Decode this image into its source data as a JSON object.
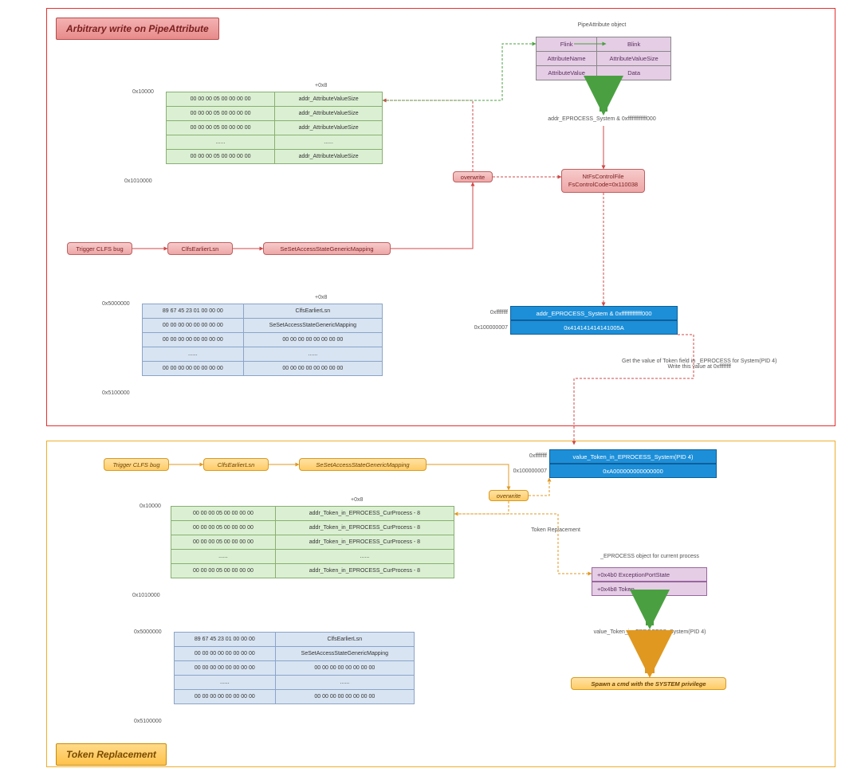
{
  "panel1": {
    "title": "Arbitrary write on PipeAttribute",
    "pipeattr_title": "PipeAttribute object",
    "pipeattr_cells": [
      "Flink",
      "Blink",
      "AttributeName",
      "AttributeValueSize",
      "AttributeValue",
      "Data"
    ],
    "addr_mask": "addr_EPROCESS_System & 0xfffffffffffff000",
    "ntfs": {
      "l1": "NtFsControlFile",
      "l2": "FsControlCode=0x110038"
    },
    "overwrite": "overwrite",
    "chain": [
      "Trigger CLFS bug",
      "ClfsEarlierLsn",
      "SeSetAccessStateGenericMapping"
    ],
    "greentbl": {
      "hdr": "+0x8",
      "addr_top": "0x10000",
      "addr_bot": "0x1010000",
      "rows": [
        [
          "00 00 00 05 00 00 00 00",
          "addr_AttributeValueSize"
        ],
        [
          "00 00 00 05 00 00 00 00",
          "addr_AttributeValueSize"
        ],
        [
          "00 00 00 05 00 00 00 00",
          "addr_AttributeValueSize"
        ],
        [
          "......",
          "......"
        ],
        [
          "00 00 00 05 00 00 00 00",
          "addr_AttributeValueSize"
        ]
      ]
    },
    "bluetbl": {
      "hdr": "+0x8",
      "addr_top": "0x5000000",
      "addr_bot": "0x5100000",
      "rows": [
        [
          "89 67 45 23 01 00 00 00",
          "ClfsEarlierLsn"
        ],
        [
          "00 00 00 00 00 00 00 00",
          "SeSetAccessStateGenericMapping"
        ],
        [
          "00 00 00 00 00 00 00 00",
          "00 00 00 00 00 00 00 00"
        ],
        [
          "......",
          "......"
        ],
        [
          "00 00 00 00 00 00 00 00",
          "00 00 00 00 00 00 00 00"
        ]
      ]
    },
    "bluewrite": {
      "addr1": "0xffffffff",
      "val1": "addr_EPROCESS_System & 0xfffffffffffff000",
      "addr2": "0x100000007",
      "val2": "0x414141414141005A"
    },
    "note": "Get the value of Token field in _EPROCESS for System(PID 4)\nWrite this value at 0xffffffff"
  },
  "panel2": {
    "title": "Token Replacement",
    "chain": [
      "Trigger CLFS bug",
      "ClfsEarlierLsn",
      "SeSetAccessStateGenericMapping"
    ],
    "overwrite": "overwrite",
    "bluewrite": {
      "addr1": "0xffffffff",
      "val1": "value_Token_in_EPROCESS_System(PID 4)",
      "addr2": "0x100000007",
      "val2": "0xA000000000000000"
    },
    "greentbl": {
      "hdr": "+0x8",
      "addr_top": "0x10000",
      "addr_bot": "0x1010000",
      "rows": [
        [
          "00 00 00 05 00 00 00 00",
          "addr_Token_in_EPROCESS_CurProcess - 8"
        ],
        [
          "00 00 00 05 00 00 00 00",
          "addr_Token_in_EPROCESS_CurProcess - 8"
        ],
        [
          "00 00 00 05 00 00 00 00",
          "addr_Token_in_EPROCESS_CurProcess - 8"
        ],
        [
          "......",
          "......"
        ],
        [
          "00 00 00 05 00 00 00 00",
          "addr_Token_in_EPROCESS_CurProcess - 8"
        ]
      ]
    },
    "bluetbl": {
      "hdr": "+0x8",
      "addr_top": "0x5000000",
      "addr_bot": "0x5100000",
      "rows": [
        [
          "89 67 45 23 01 00 00 00",
          "ClfsEarlierLsn"
        ],
        [
          "00 00 00 00 00 00 00 00",
          "SeSetAccessStateGenericMapping"
        ],
        [
          "00 00 00 00 00 00 00 00",
          "00 00 00 00 00 00 00 00"
        ],
        [
          "......",
          "......"
        ],
        [
          "00 00 00 00 00 00 00 00",
          "00 00 00 00 00 00 00 00"
        ]
      ]
    },
    "tokenrepl": "Token Replacement",
    "eproc_title": "_EPROCESS object for current process",
    "eproc_rows": [
      "+0x4b0 ExceptionPortState",
      "+0x4b8 Token"
    ],
    "value_token": "value_Token_in_EPROCESS_System(PID 4)",
    "spawn": "Spawn a cmd with the SYSTEM privilege"
  }
}
